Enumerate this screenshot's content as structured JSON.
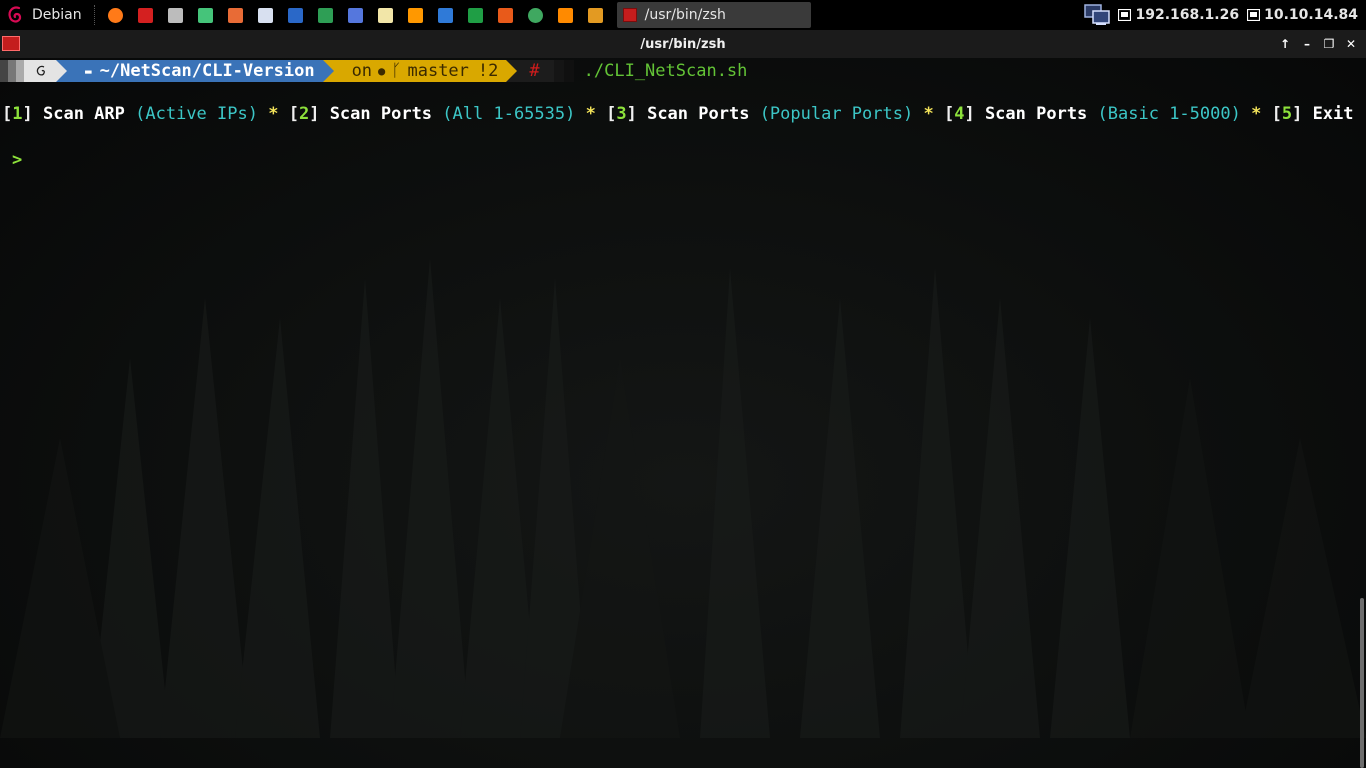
{
  "panel": {
    "menu_label": "Debian",
    "launchers": [
      {
        "name": "firefox-icon",
        "color": "#ff7a18"
      },
      {
        "name": "terminal-icon",
        "color": "#d42020"
      },
      {
        "name": "files-icon",
        "color": "#bcbcbc"
      },
      {
        "name": "app-green-icon",
        "color": "#45c47a"
      },
      {
        "name": "burp-icon",
        "color": "#e86b36"
      },
      {
        "name": "eye-icon",
        "color": "#d8e0f0"
      },
      {
        "name": "wireshark-icon",
        "color": "#2a68c8"
      },
      {
        "name": "kali-dragon-icon",
        "color": "#2e9e55"
      },
      {
        "name": "network-tool-icon",
        "color": "#5577dd"
      },
      {
        "name": "notes-icon",
        "color": "#f2e6a8"
      },
      {
        "name": "sublime-icon",
        "color": "#ff9800"
      },
      {
        "name": "writer-icon",
        "color": "#2f7ad8"
      },
      {
        "name": "calc-icon",
        "color": "#1f9e45"
      },
      {
        "name": "impress-icon",
        "color": "#e85a1a"
      },
      {
        "name": "globe-icon",
        "color": "#3fa860"
      },
      {
        "name": "vlc-icon",
        "color": "#ff8a00"
      },
      {
        "name": "search-icon",
        "color": "#e39a22"
      }
    ],
    "task_title": "/usr/bin/zsh",
    "ip_1": "192.168.1.26",
    "ip_2": "10.10.14.84"
  },
  "window": {
    "title": "/usr/bin/zsh",
    "controls": [
      "↑",
      "–",
      "❐",
      "✕"
    ]
  },
  "prompt": {
    "path": "~/NetScan/CLI-Version",
    "git_on": "on",
    "branch": "master",
    "status": "!2",
    "symbol": "#",
    "command": "./CLI_NetScan.sh"
  },
  "menu": [
    {
      "num": "1",
      "label": "Scan ARP",
      "detail": "(Active IPs)"
    },
    {
      "num": "2",
      "label": "Scan Ports",
      "detail": "(All 1-65535)"
    },
    {
      "num": "3",
      "label": "Scan Ports",
      "detail": "(Popular Ports)"
    },
    {
      "num": "4",
      "label": "Scan Ports",
      "detail": "(Basic 1-5000)"
    },
    {
      "num": "5",
      "label": "Exit",
      "detail": ""
    }
  ],
  "input_prompt": ">",
  "colors": {
    "dir_segment": "#3a73b8",
    "git_segment": "#d9a800",
    "menu_number": "#8de13b",
    "menu_detail": "#3cc6c6",
    "separator_star": "#f4e45a"
  }
}
